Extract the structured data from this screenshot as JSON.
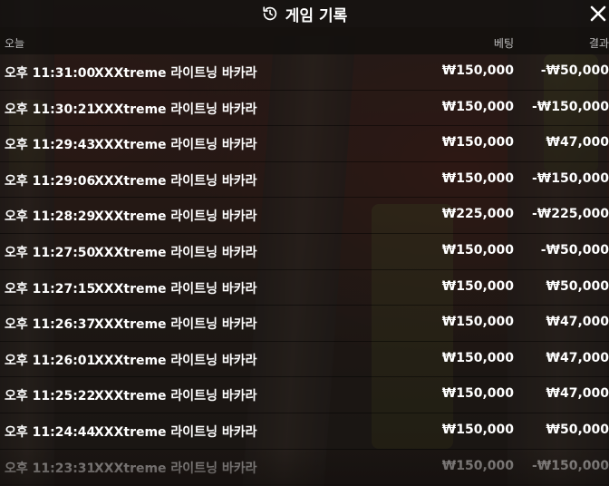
{
  "header": {
    "title": "게임 기록",
    "history_icon": "history-icon",
    "close_icon": "close-icon"
  },
  "columns": {
    "today": "오늘",
    "bet": "베팅",
    "result": "결과"
  },
  "rows": [
    {
      "time": "오후 11:31:00",
      "game": "XXXtreme 라이트닝 바카라",
      "bet": "₩150,000",
      "result": "-₩50,000"
    },
    {
      "time": "오후 11:30:21",
      "game": "XXXtreme 라이트닝 바카라",
      "bet": "₩150,000",
      "result": "-₩150,000"
    },
    {
      "time": "오후 11:29:43",
      "game": "XXXtreme 라이트닝 바카라",
      "bet": "₩150,000",
      "result": "₩47,000"
    },
    {
      "time": "오후 11:29:06",
      "game": "XXXtreme 라이트닝 바카라",
      "bet": "₩150,000",
      "result": "-₩150,000"
    },
    {
      "time": "오후 11:28:29",
      "game": "XXXtreme 라이트닝 바카라",
      "bet": "₩225,000",
      "result": "-₩225,000"
    },
    {
      "time": "오후 11:27:50",
      "game": "XXXtreme 라이트닝 바카라",
      "bet": "₩150,000",
      "result": "-₩50,000"
    },
    {
      "time": "오후 11:27:15",
      "game": "XXXtreme 라이트닝 바카라",
      "bet": "₩150,000",
      "result": "₩50,000"
    },
    {
      "time": "오후 11:26:37",
      "game": "XXXtreme 라이트닝 바카라",
      "bet": "₩150,000",
      "result": "₩47,000"
    },
    {
      "time": "오후 11:26:01",
      "game": "XXXtreme 라이트닝 바카라",
      "bet": "₩150,000",
      "result": "₩47,000"
    },
    {
      "time": "오후 11:25:22",
      "game": "XXXtreme 라이트닝 바카라",
      "bet": "₩150,000",
      "result": "₩47,000"
    },
    {
      "time": "오후 11:24:44",
      "game": "XXXtreme 라이트닝 바카라",
      "bet": "₩150,000",
      "result": "₩50,000"
    },
    {
      "time": "오후 11:23:31",
      "game": "XXXtreme 라이트닝 바카라",
      "bet": "₩150,000",
      "result": "-₩150,000"
    }
  ]
}
